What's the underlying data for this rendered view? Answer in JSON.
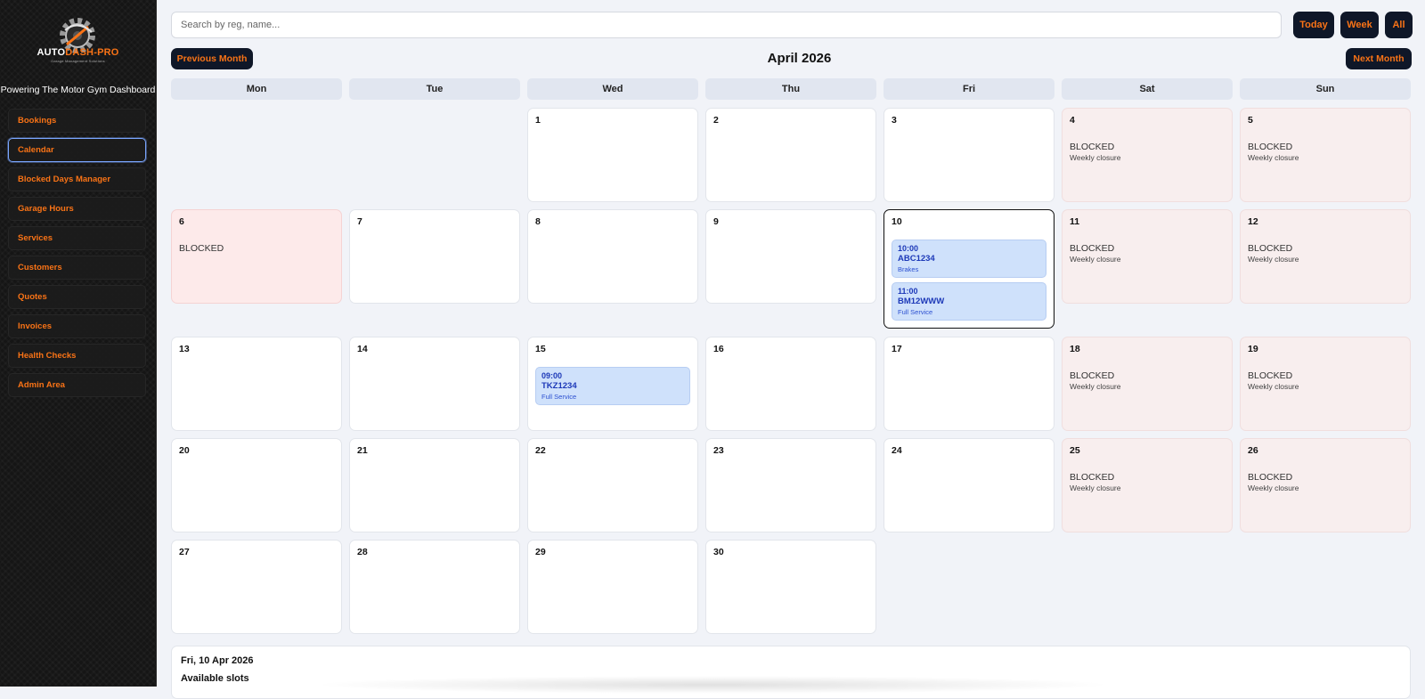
{
  "sidebar": {
    "logo_text_1": "AUTO",
    "logo_text_2": "DASH-PRO",
    "logo_sub": "Garage Management Solutions",
    "tagline": "Powering The Motor Gym Dashboard",
    "items": [
      {
        "label": "Bookings"
      },
      {
        "label": "Calendar",
        "active": true
      },
      {
        "label": "Blocked Days Manager"
      },
      {
        "label": "Garage Hours"
      },
      {
        "label": "Services"
      },
      {
        "label": "Customers"
      },
      {
        "label": "Quotes"
      },
      {
        "label": "Invoices"
      },
      {
        "label": "Health Checks"
      },
      {
        "label": "Admin Area"
      }
    ]
  },
  "toolbar": {
    "search_placeholder": "Search by reg, name...",
    "today": "Today",
    "week": "Week",
    "all": "All"
  },
  "calendar": {
    "prev": "Previous Month",
    "next": "Next Month",
    "title": "April 2026",
    "weekdays": [
      "Mon",
      "Tue",
      "Wed",
      "Thu",
      "Fri",
      "Sat",
      "Sun"
    ],
    "days": [
      {
        "n": "1"
      },
      {
        "n": "2"
      },
      {
        "n": "3"
      },
      {
        "n": "4",
        "blocked": "BLOCKED",
        "reason": "Weekly closure"
      },
      {
        "n": "5",
        "blocked": "BLOCKED",
        "reason": "Weekly closure"
      },
      {
        "n": "6",
        "blocked": "BLOCKED"
      },
      {
        "n": "7"
      },
      {
        "n": "8"
      },
      {
        "n": "9"
      },
      {
        "n": "10",
        "selected": true,
        "bookings": [
          {
            "time": "10:00",
            "reg": "ABC1234",
            "service": "Brakes"
          },
          {
            "time": "11:00",
            "reg": "BM12WWW",
            "service": "Full Service"
          }
        ]
      },
      {
        "n": "11",
        "blocked": "BLOCKED",
        "reason": "Weekly closure"
      },
      {
        "n": "12",
        "blocked": "BLOCKED",
        "reason": "Weekly closure"
      },
      {
        "n": "13"
      },
      {
        "n": "14"
      },
      {
        "n": "15",
        "bookings": [
          {
            "time": "09:00",
            "reg": "TKZ1234",
            "service": "Full Service"
          }
        ]
      },
      {
        "n": "16"
      },
      {
        "n": "17"
      },
      {
        "n": "18",
        "blocked": "BLOCKED",
        "reason": "Weekly closure"
      },
      {
        "n": "19",
        "blocked": "BLOCKED",
        "reason": "Weekly closure"
      },
      {
        "n": "20"
      },
      {
        "n": "21"
      },
      {
        "n": "22"
      },
      {
        "n": "23"
      },
      {
        "n": "24"
      },
      {
        "n": "25",
        "blocked": "BLOCKED",
        "reason": "Weekly closure"
      },
      {
        "n": "26",
        "blocked": "BLOCKED",
        "reason": "Weekly closure"
      },
      {
        "n": "27"
      },
      {
        "n": "28"
      },
      {
        "n": "29"
      },
      {
        "n": "30"
      }
    ]
  },
  "detail": {
    "date": "Fri, 10 Apr 2026",
    "slots_label": "Available slots"
  },
  "colors": {
    "accent": "#f97316",
    "dark": "#0f1728",
    "booking_bg": "#cfe1fb",
    "booking_text": "#1d39b8"
  }
}
